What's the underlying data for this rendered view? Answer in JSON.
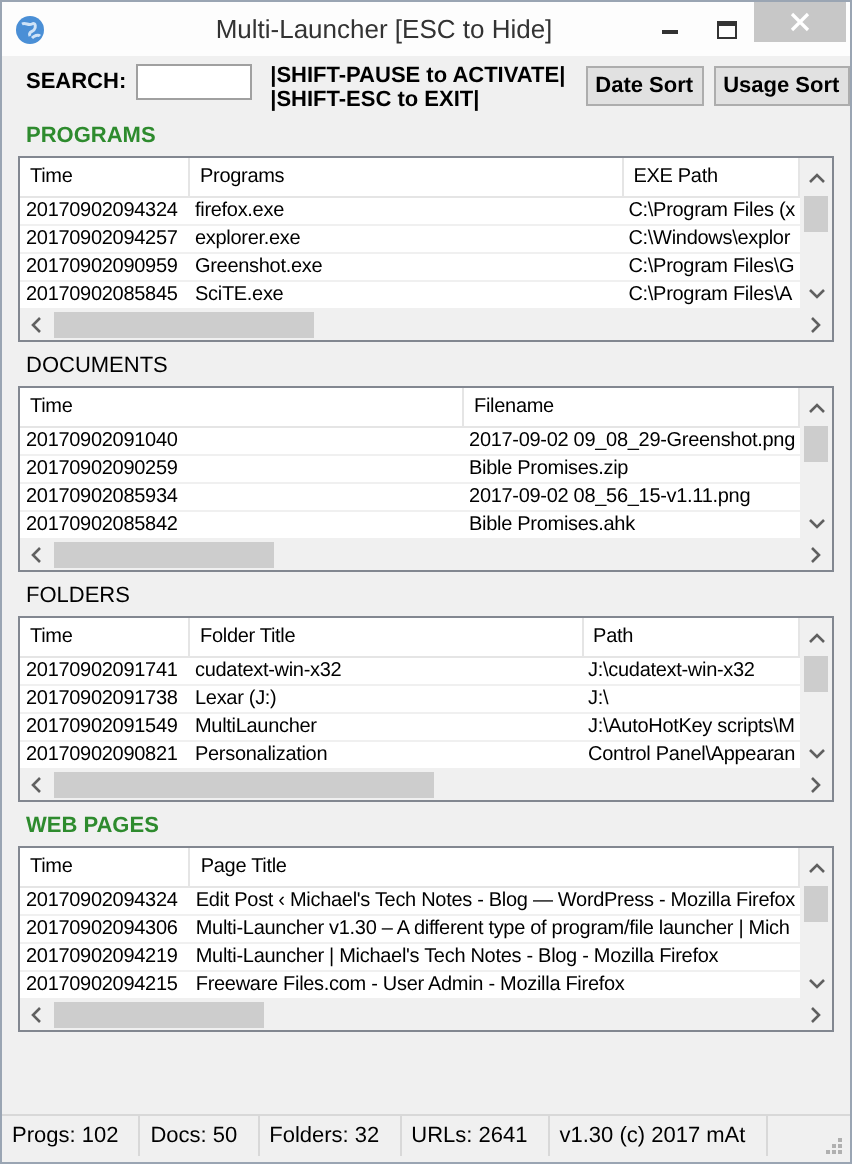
{
  "window": {
    "title": "Multi-Launcher [ESC to Hide]"
  },
  "toolbar": {
    "search_label": "SEARCH:",
    "hotkeys": [
      "|SHIFT-PAUSE to ACTIVATE|",
      "|SHIFT-ESC to EXIT|"
    ],
    "buttons": [
      "Date Sort",
      "Usage Sort"
    ]
  },
  "sections": [
    {
      "heading": "PROGRAMS",
      "highlighted": true,
      "columns": [
        "Time",
        "Programs",
        "EXE Path"
      ],
      "rows": [
        [
          "20170902094324",
          "firefox.exe",
          "C:\\Program Files (x"
        ],
        [
          "20170902094257",
          "explorer.exe",
          "C:\\Windows\\explor"
        ],
        [
          "20170902090959",
          "Greenshot.exe",
          "C:\\Program Files\\G"
        ],
        [
          "20170902085845",
          "SciTE.exe",
          "C:\\Program Files\\A"
        ]
      ]
    },
    {
      "heading": "DOCUMENTS",
      "highlighted": false,
      "columns": [
        "Time",
        "Filename"
      ],
      "rows": [
        [
          "20170902091040",
          "2017-09-02 09_08_29-Greenshot.png"
        ],
        [
          "20170902090259",
          "Bible Promises.zip"
        ],
        [
          "20170902085934",
          "2017-09-02 08_56_15-v1.11.png"
        ],
        [
          "20170902085842",
          "Bible Promises.ahk"
        ]
      ]
    },
    {
      "heading": "FOLDERS",
      "highlighted": false,
      "columns": [
        "Time",
        "Folder Title",
        "Path"
      ],
      "rows": [
        [
          "20170902091741",
          "cudatext-win-x32",
          "J:\\cudatext-win-x32"
        ],
        [
          "20170902091738",
          "Lexar (J:)",
          "J:\\"
        ],
        [
          "20170902091549",
          "MultiLauncher",
          "J:\\AutoHotKey scripts\\M"
        ],
        [
          "20170902090821",
          "Personalization",
          "Control Panel\\Appearan"
        ]
      ]
    },
    {
      "heading": "WEB PAGES",
      "highlighted": true,
      "columns": [
        "Time",
        "Page Title"
      ],
      "rows": [
        [
          "20170902094324",
          "Edit Post ‹ Michael's Tech Notes - Blog — WordPress - Mozilla Firefox"
        ],
        [
          "20170902094306",
          "Multi-Launcher v1.30 – A different type of program/file launcher | Mich"
        ],
        [
          "20170902094219",
          "Multi-Launcher | Michael's Tech Notes - Blog - Mozilla Firefox"
        ],
        [
          "20170902094215",
          "Freeware Files.com - User Admin - Mozilla Firefox"
        ]
      ]
    }
  ],
  "status_bar": [
    "Progs: 102",
    "Docs: 50",
    "Folders: 32",
    "URLs: 2641",
    "v1.30 (c) 2017 mAt"
  ]
}
